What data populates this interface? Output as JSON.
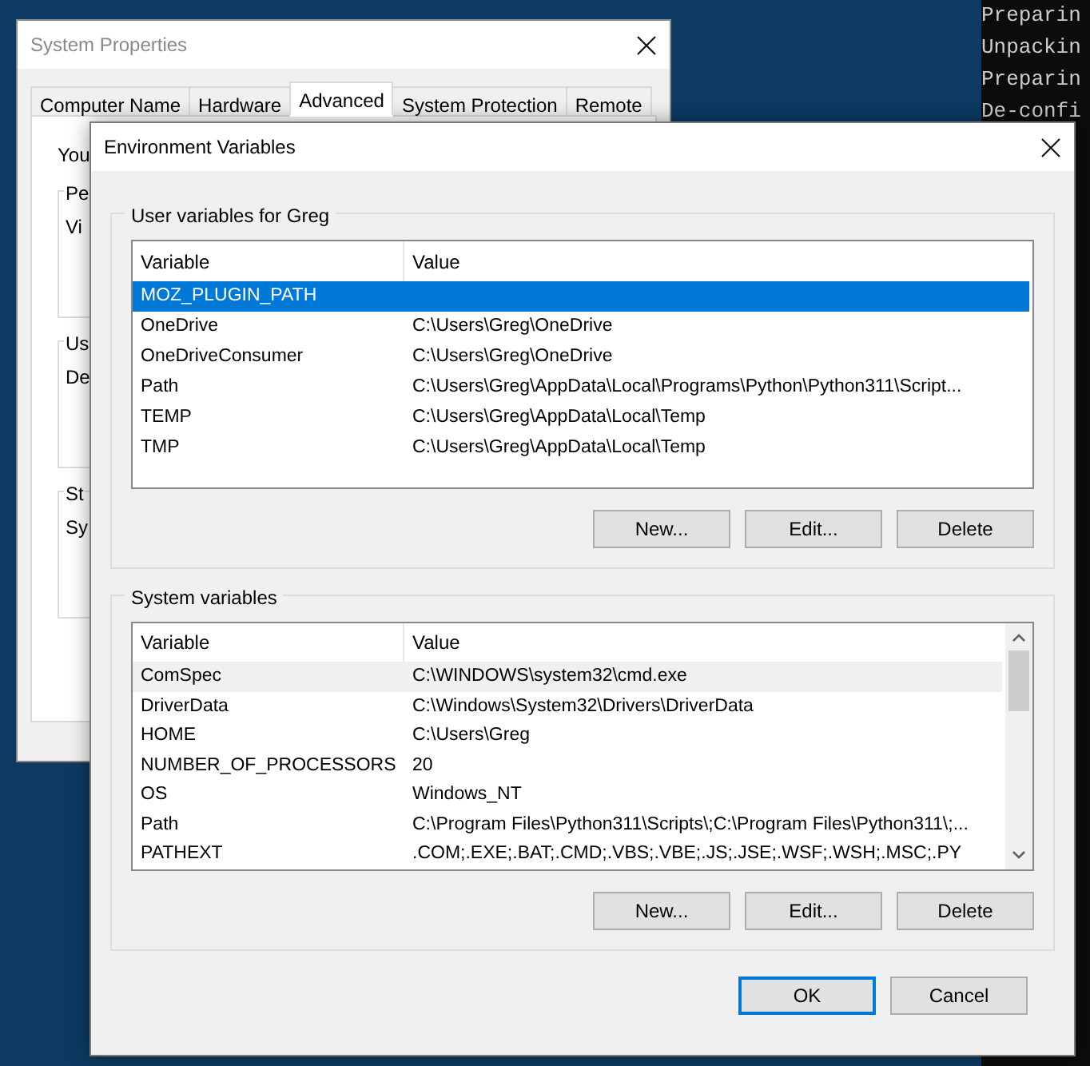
{
  "terminal": {
    "lines": [
      "Preparin",
      "Unpackin",
      "Preparin",
      "De-confi"
    ]
  },
  "system_properties": {
    "title": "System Properties",
    "tabs": [
      {
        "label": "Computer Name",
        "selected": false
      },
      {
        "label": "Hardware",
        "selected": false
      },
      {
        "label": "Advanced",
        "selected": true
      },
      {
        "label": "System Protection",
        "selected": false
      },
      {
        "label": "Remote",
        "selected": false
      }
    ],
    "intro": "You",
    "groups": [
      {
        "title": "Pe",
        "text": "Vi"
      },
      {
        "title": "Us",
        "text": "De"
      },
      {
        "title": "St",
        "text": "Sy"
      }
    ]
  },
  "dialog": {
    "title": "Environment Variables",
    "sections": [
      {
        "title": "User variables for Greg",
        "focused": true,
        "scrollbar": false,
        "columns": [
          "Variable",
          "Value"
        ],
        "rows": [
          {
            "variable": "MOZ_PLUGIN_PATH",
            "value": "",
            "selected": true
          },
          {
            "variable": "OneDrive",
            "value": "C:\\Users\\Greg\\OneDrive",
            "selected": false
          },
          {
            "variable": "OneDriveConsumer",
            "value": "C:\\Users\\Greg\\OneDrive",
            "selected": false
          },
          {
            "variable": "Path",
            "value": "C:\\Users\\Greg\\AppData\\Local\\Programs\\Python\\Python311\\Script...",
            "selected": false
          },
          {
            "variable": "TEMP",
            "value": "C:\\Users\\Greg\\AppData\\Local\\Temp",
            "selected": false
          },
          {
            "variable": "TMP",
            "value": "C:\\Users\\Greg\\AppData\\Local\\Temp",
            "selected": false
          }
        ],
        "buttons": [
          "New...",
          "Edit...",
          "Delete"
        ]
      },
      {
        "title": "System variables",
        "focused": false,
        "scrollbar": true,
        "columns": [
          "Variable",
          "Value"
        ],
        "rows": [
          {
            "variable": "ComSpec",
            "value": "C:\\WINDOWS\\system32\\cmd.exe",
            "selected": true
          },
          {
            "variable": "DriverData",
            "value": "C:\\Windows\\System32\\Drivers\\DriverData",
            "selected": false
          },
          {
            "variable": "HOME",
            "value": "C:\\Users\\Greg",
            "selected": false
          },
          {
            "variable": "NUMBER_OF_PROCESSORS",
            "value": "20",
            "selected": false
          },
          {
            "variable": "OS",
            "value": "Windows_NT",
            "selected": false
          },
          {
            "variable": "Path",
            "value": "C:\\Program Files\\Python311\\Scripts\\;C:\\Program Files\\Python311\\;...",
            "selected": false
          },
          {
            "variable": "PATHEXT",
            "value": ".COM;.EXE;.BAT;.CMD;.VBS;.VBE;.JS;.JSE;.WSF;.WSH;.MSC;.PY",
            "selected": false
          }
        ],
        "buttons": [
          "New...",
          "Edit...",
          "Delete"
        ]
      }
    ],
    "footer_buttons": [
      {
        "label": "OK",
        "default": true
      },
      {
        "label": "Cancel",
        "default": false
      }
    ]
  }
}
